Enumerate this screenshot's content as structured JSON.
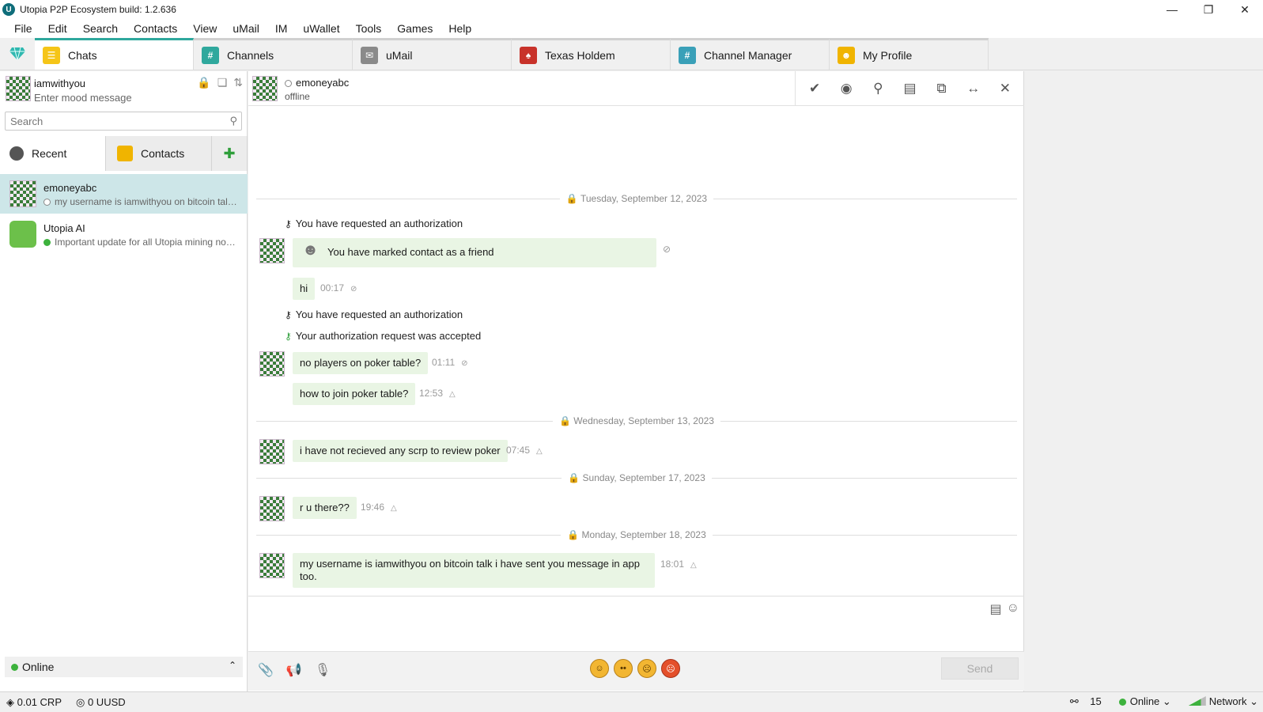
{
  "window": {
    "title": "Utopia P2P Ecosystem build: 1.2.636",
    "app_icon": "U"
  },
  "menu": [
    "File",
    "Edit",
    "Search",
    "Contacts",
    "View",
    "uMail",
    "IM",
    "uWallet",
    "Tools",
    "Games",
    "Help"
  ],
  "tabs": [
    {
      "label": "Chats",
      "icon": "chats-icon",
      "color": "#f5c518"
    },
    {
      "label": "Channels",
      "icon": "channels-icon",
      "color": "#2fa89d"
    },
    {
      "label": "uMail",
      "icon": "mail-icon",
      "color": "#8a8a8a"
    },
    {
      "label": "Texas Holdem",
      "icon": "cards-icon",
      "color": "#c8322a"
    },
    {
      "label": "Channel Manager",
      "icon": "channel-manager-icon",
      "color": "#3aa0b8"
    },
    {
      "label": "My Profile",
      "icon": "profile-icon",
      "color": "#f0b400"
    }
  ],
  "profile": {
    "name": "iamwithyou",
    "mood_placeholder": "Enter mood message"
  },
  "search": {
    "placeholder": "Search"
  },
  "subtabs": {
    "recent": "Recent",
    "contacts": "Contacts"
  },
  "conversations": [
    {
      "name": "emoneyabc",
      "preview": "my username is iamwithyou on bitcoin talk i have sent you message in app too.",
      "online": false
    },
    {
      "name": "Utopia AI",
      "preview": "Important update for all Utopia mining nodes",
      "online": true
    }
  ],
  "status": {
    "label": "Online"
  },
  "chat": {
    "peer_name": "emoneyabc",
    "peer_status": "offline",
    "days": [
      "Tuesday, September 12, 2023",
      "Wednesday, September 13, 2023",
      "Sunday, September 17, 2023",
      "Monday, September 18, 2023"
    ],
    "system": {
      "auth_requested": "You have requested an authorization",
      "marked_friend": "You have marked contact as a friend",
      "auth_accepted": "Your authorization request was accepted"
    },
    "messages": [
      {
        "text": "hi",
        "time": "00:17"
      },
      {
        "text": "no players on poker table?",
        "time": "01:11"
      },
      {
        "text": "how to join poker table?",
        "time": "12:53"
      },
      {
        "text": "i have not recieved any scrp to review poker",
        "time": "07:45"
      },
      {
        "text": "r u there??",
        "time": "19:46"
      },
      {
        "text": "my username is iamwithyou on bitcoin talk i have sent you message in app too.",
        "time": "18:01"
      }
    ],
    "send_label": "Send"
  },
  "statusbar": {
    "crp": "0.01 CRP",
    "uusd": "0 UUSD",
    "peers": "15",
    "online": "Online",
    "network": "Network"
  }
}
